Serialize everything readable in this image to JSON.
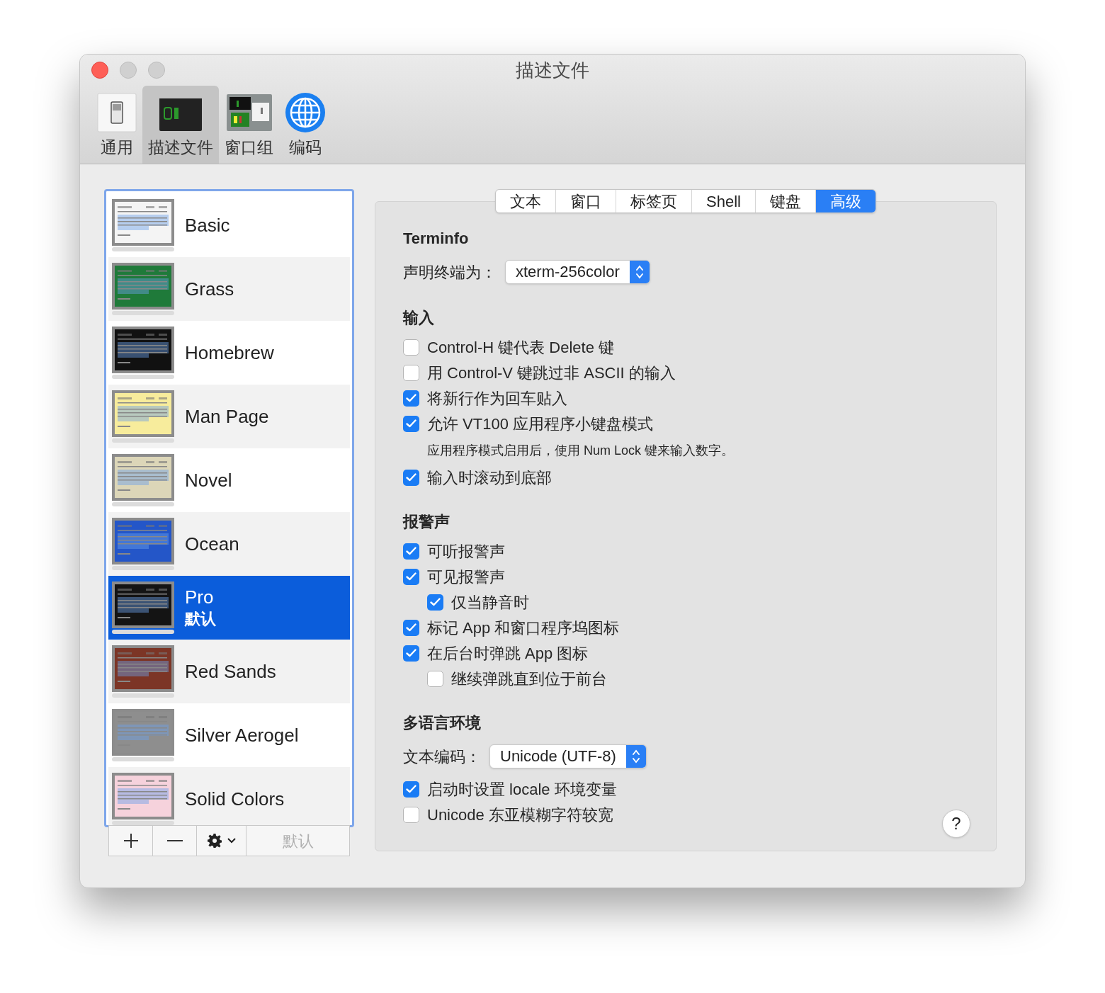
{
  "window": {
    "title": "描述文件"
  },
  "toolbar": [
    {
      "label": "通用",
      "kind": "general",
      "selected": false
    },
    {
      "label": "描述文件",
      "kind": "profiles",
      "selected": true
    },
    {
      "label": "窗口组",
      "kind": "groups",
      "selected": false
    },
    {
      "label": "编码",
      "kind": "encoding",
      "selected": false
    }
  ],
  "profiles": [
    {
      "name": "Basic",
      "color": "#f4f4f4",
      "selected": false
    },
    {
      "name": "Grass",
      "color": "#1f7a3a",
      "selected": false
    },
    {
      "name": "Homebrew",
      "color": "#111111",
      "selected": false
    },
    {
      "name": "Man Page",
      "color": "#f7ec9c",
      "selected": false
    },
    {
      "name": "Novel",
      "color": "#dcd6b8",
      "selected": false
    },
    {
      "name": "Ocean",
      "color": "#2456c8",
      "selected": false
    },
    {
      "name": "Pro",
      "subtitle": "默认",
      "color": "#141414",
      "selected": true
    },
    {
      "name": "Red Sands",
      "color": "#7c3526",
      "selected": false
    },
    {
      "name": "Silver Aerogel",
      "color": "#8e8e8e",
      "selected": false
    },
    {
      "name": "Solid Colors",
      "color": "#f6d2dc",
      "selected": false
    }
  ],
  "list_buttons": {
    "default_label": "默认",
    "default_disabled": true
  },
  "tabs": [
    {
      "label": "文本",
      "selected": false
    },
    {
      "label": "窗口",
      "selected": false
    },
    {
      "label": "标签页",
      "selected": false
    },
    {
      "label": "Shell",
      "selected": false
    },
    {
      "label": "键盘",
      "selected": false
    },
    {
      "label": "高级",
      "selected": true
    }
  ],
  "sections": [
    {
      "title": "Terminfo",
      "items": [
        {
          "kind": "select",
          "label": "声明终端为：",
          "value": "xterm-256color"
        }
      ]
    },
    {
      "title": "输入",
      "items": [
        {
          "kind": "checkbox",
          "label": "Control-H 键代表 Delete 键",
          "checked": false
        },
        {
          "kind": "checkbox",
          "label": "用 Control-V 键跳过非 ASCII 的输入",
          "checked": false
        },
        {
          "kind": "checkbox",
          "label": "将新行作为回车贴入",
          "checked": true
        },
        {
          "kind": "checkbox",
          "label": "允许 VT100 应用程序小键盘模式",
          "checked": true
        },
        {
          "kind": "note",
          "label": "应用程序模式启用后，使用 Num Lock 键来输入数字。"
        },
        {
          "kind": "checkbox",
          "label": "输入时滚动到底部",
          "checked": true
        }
      ]
    },
    {
      "title": "报警声",
      "items": [
        {
          "kind": "checkbox",
          "label": "可听报警声",
          "checked": true
        },
        {
          "kind": "checkbox",
          "label": "可见报警声",
          "checked": true,
          "children": [
            {
              "kind": "checkbox",
              "label": "仅当静音时",
              "checked": true
            }
          ]
        },
        {
          "kind": "checkbox",
          "label": "标记 App 和窗口程序坞图标",
          "checked": true
        },
        {
          "kind": "checkbox",
          "label": "在后台时弹跳 App 图标",
          "checked": true,
          "children": [
            {
              "kind": "checkbox",
              "label": "继续弹跳直到位于前台",
              "checked": false
            }
          ]
        }
      ]
    },
    {
      "title": "多语言环境",
      "items": [
        {
          "kind": "select",
          "label": "文本编码：",
          "value": "Unicode (UTF-8)"
        },
        {
          "kind": "checkbox",
          "label": "启动时设置 locale 环境变量",
          "checked": true
        },
        {
          "kind": "checkbox",
          "label": "Unicode 东亚模糊字符较宽",
          "checked": false
        }
      ]
    }
  ],
  "help_button": "?"
}
